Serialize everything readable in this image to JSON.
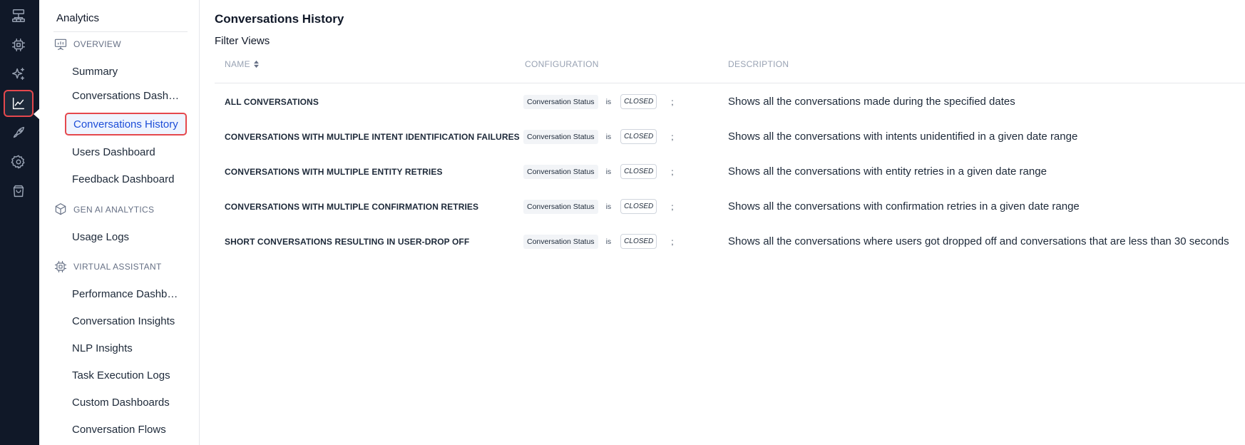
{
  "rail": {
    "items": [
      {
        "icon": "sitemap-icon"
      },
      {
        "icon": "chip-icon"
      },
      {
        "icon": "sparkles-icon"
      },
      {
        "icon": "chart-line-icon",
        "active": true
      },
      {
        "icon": "rocket-icon"
      },
      {
        "icon": "gear-icon"
      },
      {
        "icon": "shopping-bag-icon"
      }
    ]
  },
  "sidebar": {
    "title": "Analytics",
    "sections": [
      {
        "label": "OVERVIEW",
        "icon": "presentation-icon",
        "items": [
          "Summary",
          "Conversations Dashboard",
          "Conversations History",
          "Users Dashboard",
          "Feedback Dashboard"
        ]
      },
      {
        "label": "GEN AI ANALYTICS",
        "icon": "ai-cube-icon",
        "items": [
          "Usage Logs"
        ]
      },
      {
        "label": "VIRTUAL ASSISTANT",
        "icon": "bot-chip-icon",
        "items": [
          "Performance Dashboard",
          "Conversation Insights",
          "NLP Insights",
          "Task Execution Logs",
          "Custom Dashboards",
          "Conversation Flows"
        ]
      }
    ],
    "active_item": "Conversations History"
  },
  "main": {
    "title": "Conversations History",
    "subtitle": "Filter Views",
    "columns": {
      "name": "NAME",
      "configuration": "CONFIGURATION",
      "description": "DESCRIPTION"
    },
    "rows": [
      {
        "name": "ALL CONVERSATIONS",
        "field": "Conversation Status",
        "op": "is",
        "value": "CLOSED",
        "sep": ";",
        "description": "Shows all the conversations made during the specified dates"
      },
      {
        "name": "CONVERSATIONS WITH MULTIPLE INTENT IDENTIFICATION FAILURES",
        "field": "Conversation Status",
        "op": "is",
        "value": "CLOSED",
        "sep": ";",
        "description": "Shows all the conversations with intents unidentified in a given date range"
      },
      {
        "name": "CONVERSATIONS WITH MULTIPLE ENTITY RETRIES",
        "field": "Conversation Status",
        "op": "is",
        "value": "CLOSED",
        "sep": ";",
        "description": "Shows all the conversations with entity retries in a given date range"
      },
      {
        "name": "CONVERSATIONS WITH MULTIPLE CONFIRMATION RETRIES",
        "field": "Conversation Status",
        "op": "is",
        "value": "CLOSED",
        "sep": ";",
        "description": "Shows all the conversations with confirmation retries in a given date range"
      },
      {
        "name": "SHORT CONVERSATIONS RESULTING IN USER-DROP OFF",
        "field": "Conversation Status",
        "op": "is",
        "value": "CLOSED",
        "sep": ";",
        "description": "Shows all the conversations where users got dropped off and conversations that are less than 30 seconds"
      }
    ]
  },
  "colors": {
    "rail_bg": "#101828",
    "active_outline": "#e5484d",
    "active_text": "#1d4ed8",
    "active_bg": "#eef4ff"
  }
}
